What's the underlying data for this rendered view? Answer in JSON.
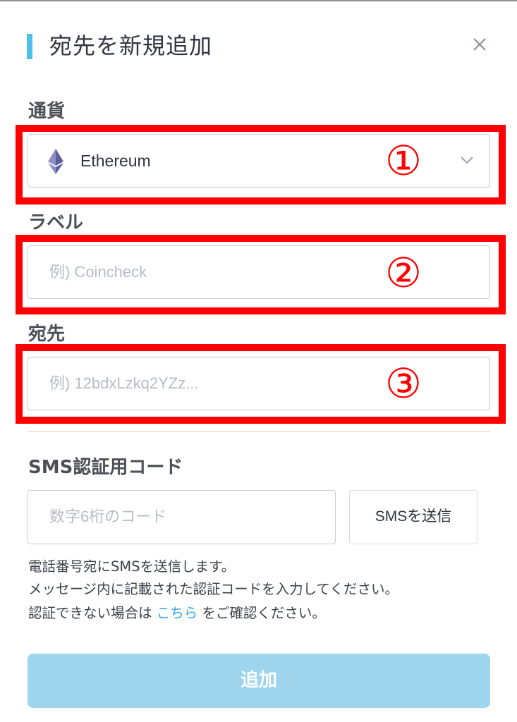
{
  "header": {
    "title": "宛先を新規追加",
    "close_icon": "close-icon"
  },
  "currency": {
    "label": "通貨",
    "selected_value": "Ethereum",
    "icon": "ethereum-icon",
    "annotation": "①"
  },
  "label_field": {
    "label": "ラベル",
    "placeholder": "例) Coincheck",
    "value": "",
    "annotation": "②"
  },
  "address_field": {
    "label": "宛先",
    "placeholder": "例) 12bdxLzkq2YZz...",
    "value": "",
    "annotation": "③"
  },
  "sms": {
    "label": "SMS認証用コード",
    "placeholder": "数字6桁のコード",
    "send_button": "SMSを送信",
    "note_line1": "電話番号宛にSMSを送信します。",
    "note_line2": "メッセージ内に記載された認証コードを入力してください。",
    "note_line3_prefix": "認証できない場合は ",
    "note_link": "こちら",
    "note_line3_suffix": " をご確認ください。"
  },
  "submit_label": "追加",
  "colors": {
    "accent": "#4fc0ea",
    "submit_disabled": "#9ed5ec",
    "annotation_red": "#ff0000",
    "link": "#3aa6dc"
  }
}
